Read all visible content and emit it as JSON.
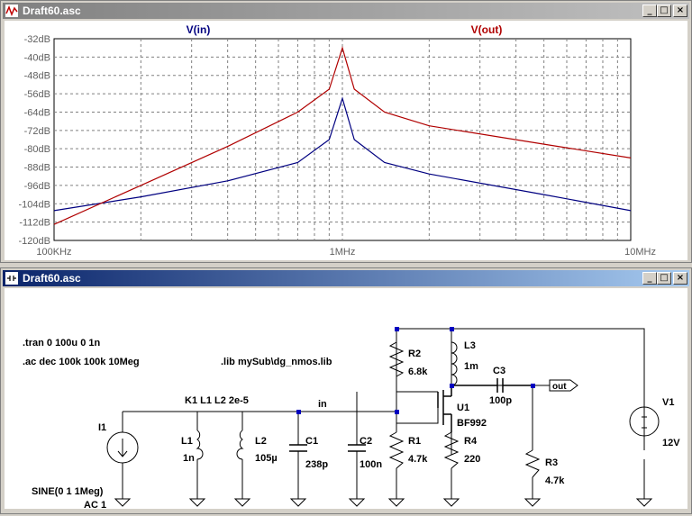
{
  "plot_window": {
    "title": "Draft60.asc",
    "buttons": {
      "minimize": "_",
      "maximize": "□",
      "close": "×"
    }
  },
  "schematic_window": {
    "title": "Draft60.asc",
    "buttons": {
      "minimize": "_",
      "maximize": "□",
      "close": "×"
    }
  },
  "chart_data": {
    "type": "line",
    "x_scale": "log",
    "xlim": [
      100000,
      10000000
    ],
    "ylim": [
      -120,
      -32
    ],
    "x_tick_labels": [
      "100KHz",
      "1MHz",
      "10MHz"
    ],
    "y_tick_labels": [
      "-32dB",
      "-40dB",
      "-48dB",
      "-56dB",
      "-64dB",
      "-72dB",
      "-80dB",
      "-88dB",
      "-96dB",
      "-104dB",
      "-112dB",
      "-120dB"
    ],
    "grid": true,
    "series": [
      {
        "name": "V(in)",
        "color": "#000080",
        "x": [
          100000,
          200000,
          400000,
          700000,
          900000,
          1000000,
          1100000,
          1400000,
          2000000,
          5000000,
          10000000
        ],
        "values": [
          -107,
          -101,
          -94,
          -86,
          -76,
          -58,
          -76,
          -86,
          -91,
          -100,
          -107
        ]
      },
      {
        "name": "V(out)",
        "color": "#b00000",
        "x": [
          100000,
          200000,
          400000,
          700000,
          900000,
          1000000,
          1100000,
          1400000,
          2000000,
          5000000,
          10000000
        ],
        "values": [
          -113,
          -96,
          -79,
          -64,
          -54,
          -36,
          -54,
          -64,
          -70,
          -78,
          -84
        ]
      }
    ]
  },
  "schematic": {
    "directives": [
      ".tran 0 100u 0 1n",
      ".ac dec 100k 100k 10Meg",
      ".lib mySub\\dg_nmos.lib"
    ],
    "coupling": "K1 L1 L2 2e-5",
    "nets": {
      "in": "in",
      "out": "out"
    },
    "source_i1": {
      "ref": "I1",
      "value": "SINE(0 1 1Meg)",
      "ac": "AC 1"
    },
    "components": {
      "L1": {
        "ref": "L1",
        "value": "1n"
      },
      "L2": {
        "ref": "L2",
        "value": "105µ"
      },
      "C1": {
        "ref": "C1",
        "value": "238p"
      },
      "C2": {
        "ref": "C2",
        "value": "100n"
      },
      "R1": {
        "ref": "R1",
        "value": "4.7k"
      },
      "R2": {
        "ref": "R2",
        "value": "6.8k"
      },
      "L3": {
        "ref": "L3",
        "value": "1m"
      },
      "U1": {
        "ref": "U1",
        "value": "BF992"
      },
      "R4": {
        "ref": "R4",
        "value": "220"
      },
      "C3": {
        "ref": "C3",
        "value": "100p"
      },
      "R3": {
        "ref": "R3",
        "value": "4.7k"
      },
      "V1": {
        "ref": "V1",
        "value": "12V"
      }
    }
  }
}
